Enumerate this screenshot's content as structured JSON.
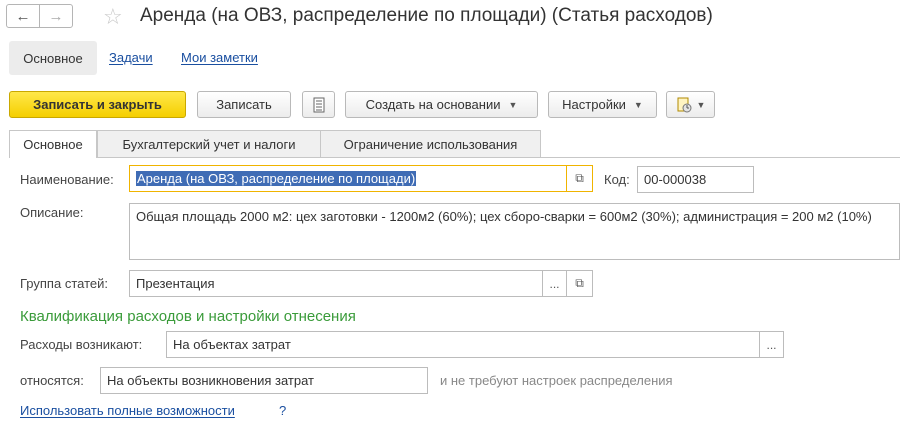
{
  "window": {
    "title": "Аренда (на ОВЗ, распределение по площади) (Статья расходов)"
  },
  "command_panel": {
    "items": [
      "Основное",
      "Задачи",
      "Мои заметки"
    ]
  },
  "toolbar": {
    "save_close": "Записать и закрыть",
    "save": "Записать",
    "create_based": "Создать на основании",
    "settings": "Настройки"
  },
  "tabs": [
    "Основное",
    "Бухгалтерский учет и налоги",
    "Ограничение использования"
  ],
  "form": {
    "name_label": "Наименование:",
    "name_value": "Аренда (на ОВЗ, распределение по площади)",
    "code_label": "Код:",
    "code_value": "00-000038",
    "description_label": "Описание:",
    "description_value": "Общая площадь 2000 м2: цех заготовки - 1200м2 (60%); цех сборо-сварки = 600м2 (30%); администрация = 200 м2 (10%)",
    "group_label": "Группа статей:",
    "group_value": "Презентация",
    "section_title": "Квалификация расходов и настройки отнесения",
    "arise_label": "Расходы возникают:",
    "arise_value": "На объектах затрат",
    "assigned_label": "относятся:",
    "assigned_value": "На объекты возникновения затрат",
    "distribution_note": "и не требуют настроек распределения",
    "full_features_link": "Использовать полные возможности",
    "help": "?"
  }
}
